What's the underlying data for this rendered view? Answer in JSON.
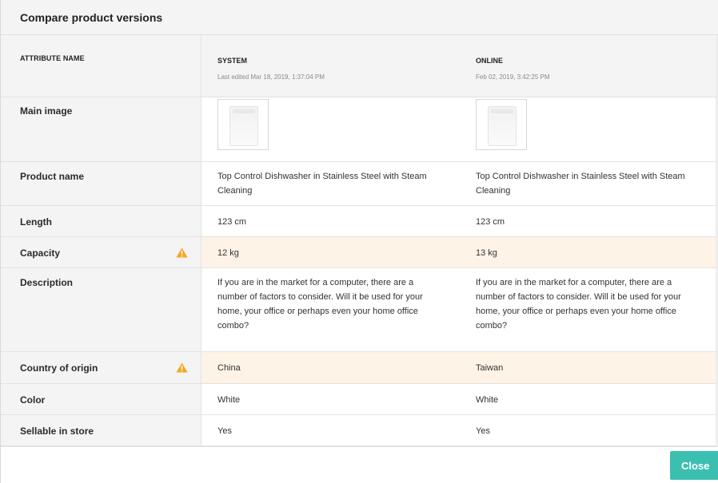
{
  "dialog": {
    "title": "Compare product versions",
    "close_label": "Close"
  },
  "table": {
    "header": {
      "attribute": "ATTRIBUTE NAME",
      "system": {
        "title": "SYSTEM",
        "subtitle": "Last edited  Mar 18, 2019, 1:37:04 PM"
      },
      "online": {
        "title": "ONLINE",
        "subtitle": "Feb 02, 2019, 3:42:25 PM"
      }
    },
    "rows": [
      {
        "attribute": "Main image",
        "system": "",
        "online": "",
        "type": "image",
        "warning": false
      },
      {
        "attribute": "Product name",
        "system": "Top Control Dishwasher in Stainless Steel with Steam Cleaning",
        "online": "Top Control Dishwasher in Stainless Steel with Steam Cleaning",
        "warning": false
      },
      {
        "attribute": "Length",
        "system": "123 cm",
        "online": "123 cm",
        "warning": false
      },
      {
        "attribute": "Capacity",
        "system": "12 kg",
        "online": "13 kg",
        "warning": true
      },
      {
        "attribute": "Description",
        "system": "If you are in the market for a computer, there are a number of factors to consider. Will it be used for your home, your office or perhaps even your home office combo?",
        "online": "If you are in the market for a computer, there are a number of factors to consider. Will it be used for your home, your office or perhaps even your home office combo?",
        "warning": false
      },
      {
        "attribute": "Country of origin",
        "system": "China",
        "online": "Taiwan",
        "warning": true
      },
      {
        "attribute": "Color",
        "system": "White",
        "online": "White",
        "warning": false
      },
      {
        "attribute": "Sellable in store",
        "system": "Yes",
        "online": "Yes",
        "warning": false
      }
    ]
  },
  "icons": {
    "warning": "warning-triangle-icon",
    "product_image": "washing-machine-thumbnail"
  },
  "colors": {
    "accent": "#3bbfb0",
    "warning": "#f4a623",
    "warning_row_bg": "#fdf3e6",
    "attr_column_bg": "#f4f4f4"
  }
}
